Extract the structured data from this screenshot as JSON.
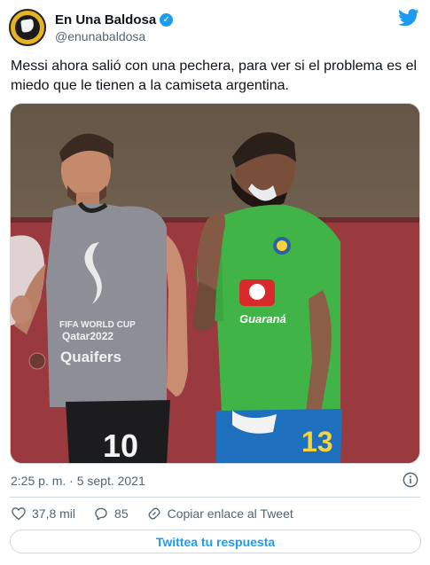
{
  "author": {
    "display_name": "En Una Baldosa",
    "handle": "@enunabaldosa",
    "verified_icon": "verified-badge-icon",
    "avatar_icon": "baldosa-logo-avatar"
  },
  "brand_icon": "twitter-bird-icon",
  "tweet": {
    "text": "Messi ahora salió con una pechera, para ver si el problema es el miedo que le tienen a la camiseta argentina."
  },
  "media": {
    "vest_logo_line1": "FIFA WORLD CUP",
    "vest_logo_line2": "Qatar2022",
    "vest_logo_line3": "Quaifers",
    "shorts_number_left": "10",
    "shirt_logo_right": "Guaraná",
    "shorts_number_right": "13"
  },
  "meta": {
    "timestamp": "2:25 p. m. · 5 sept. 2021",
    "info_icon": "info-icon"
  },
  "actions": {
    "like_count": "37,8 mil",
    "reply_count": "85",
    "copy_link_label": "Copiar enlace al Tweet"
  },
  "reply_button_label": "Twittea tu respuesta",
  "colors": {
    "accent": "#1d9bf0",
    "muted": "#536471",
    "border": "#cfd9de"
  }
}
